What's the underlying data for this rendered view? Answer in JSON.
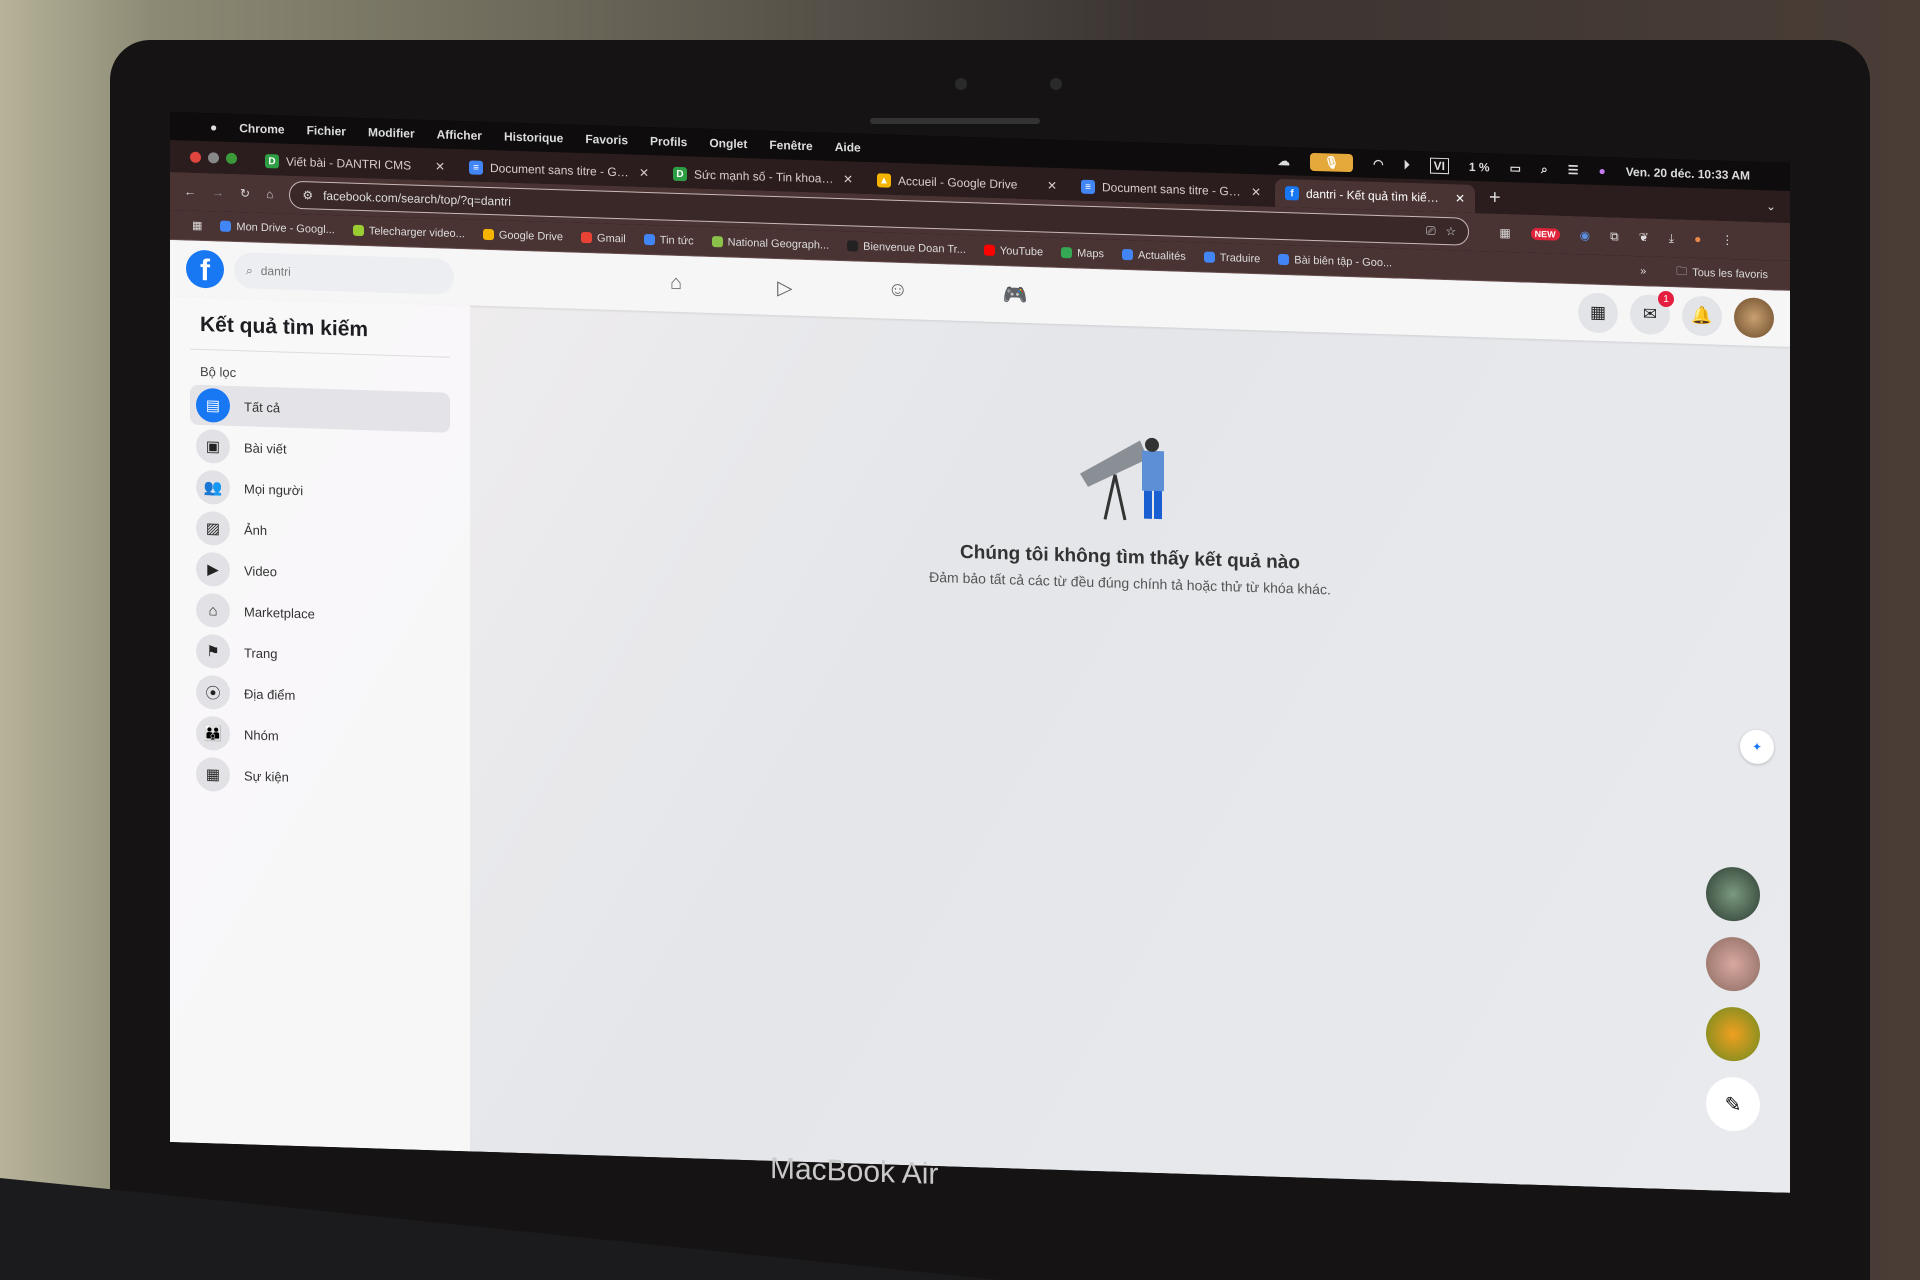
{
  "colors": {
    "fb_blue": "#1877f2",
    "chrome_frame": "#4a3333",
    "menubar": "#0e0c0c"
  },
  "device": {
    "brand": "MacBook Air"
  },
  "menubar": {
    "items": [
      "Chrome",
      "Fichier",
      "Modifier",
      "Afficher",
      "Historique",
      "Favoris",
      "Profils",
      "Onglet",
      "Fenêtre",
      "Aide"
    ],
    "keyboard": "VI",
    "battery": "1 %",
    "datetime": "Ven. 20 déc.  10:33 AM"
  },
  "tabs": [
    {
      "title": "Viết bài - DANTRI CMS",
      "icon": "D",
      "color": "#2e9e45"
    },
    {
      "title": "Document sans titre - Google",
      "icon": "≡",
      "color": "#4285f4"
    },
    {
      "title": "Sức mạnh số - Tin khoa học",
      "icon": "D",
      "color": "#2e9e45"
    },
    {
      "title": "Accueil - Google Drive",
      "icon": "▲",
      "color": "#f4b400"
    },
    {
      "title": "Document sans titre - Google",
      "icon": "≡",
      "color": "#4285f4"
    },
    {
      "title": "dantri - Kết quả tìm kiếm | Facebook",
      "icon": "f",
      "color": "#1877f2",
      "active": true
    }
  ],
  "toolbar": {
    "url": "facebook.com/search/top/?q=dantri",
    "new_badge": "NEW"
  },
  "bookmarks": {
    "items": [
      "Mon Drive - Googl...",
      "Telecharger video...",
      "Google Drive",
      "Gmail",
      "Tin tức",
      "National Geograph...",
      "Bienvenue Doan Tr...",
      "YouTube",
      "Maps",
      "Actualités",
      "Traduire",
      "Bài biên tập - Goo..."
    ],
    "overflow": "»",
    "all": "Tous les favoris"
  },
  "facebook": {
    "search_value": "dantri",
    "messenger_badge": "1",
    "sidebar": {
      "title": "Kết quả tìm kiếm",
      "filters_label": "Bộ lọc",
      "items": [
        {
          "label": "Tất cả",
          "icon": "▤",
          "selected": true
        },
        {
          "label": "Bài viết",
          "icon": "▣"
        },
        {
          "label": "Mọi người",
          "icon": "👥"
        },
        {
          "label": "Ảnh",
          "icon": "▨"
        },
        {
          "label": "Video",
          "icon": "▶"
        },
        {
          "label": "Marketplace",
          "icon": "⌂"
        },
        {
          "label": "Trang",
          "icon": "⚑"
        },
        {
          "label": "Địa điểm",
          "icon": "⦿"
        },
        {
          "label": "Nhóm",
          "icon": "👪"
        },
        {
          "label": "Sự kiện",
          "icon": "▦"
        }
      ]
    },
    "empty": {
      "title": "Chúng tôi không tìm thấy kết quả nào",
      "message": "Đảm bảo tất cả các từ đều đúng chính tả hoặc thử từ khóa khác."
    }
  }
}
